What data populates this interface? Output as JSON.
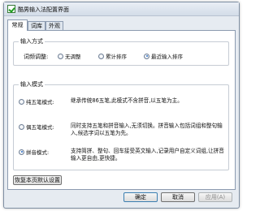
{
  "window": {
    "title": "酷男输入法配置界面"
  },
  "tabs": [
    {
      "label": "常规"
    },
    {
      "label": "词库"
    },
    {
      "label": "外观"
    }
  ],
  "input_method": {
    "group_title": "输入方式",
    "freq_label": "词频调整:",
    "options": [
      {
        "label": "无调整"
      },
      {
        "label": "累计排序"
      },
      {
        "label": "最近输入排序"
      }
    ],
    "selected": "最近输入排序"
  },
  "input_mode": {
    "group_title": "输入模式",
    "modes": [
      {
        "label": "纯五笔模式:",
        "desc": "继承传统86五笔,此模式不含拼音,以五笔为主。"
      },
      {
        "label": "偶五笔模式:",
        "desc": "同时支持五笔和拼音输入,无须切换。拼音输入包括词组和整句输入,候选字词以五笔为先。"
      },
      {
        "label": "拼音模式:",
        "desc": "支持简拼、整句、回车接受英文输入,记录用户自定义词组,让拼音输入更自由,更快捷。"
      }
    ],
    "selected": "拼音模式:"
  },
  "buttons": {
    "reset": "恢复本页默认设置",
    "ok": "确定",
    "cancel": "取消",
    "apply": "应用(A)"
  }
}
